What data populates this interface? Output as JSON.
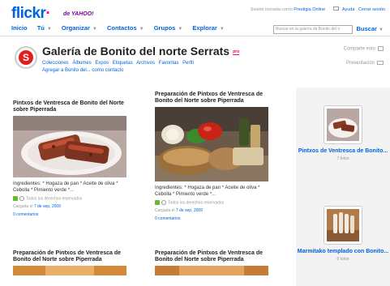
{
  "header": {
    "logo_part1": "flickr",
    "logo_part2": "·",
    "logo_sub": "de YAHOO!",
    "session_prefix": "Sesión iniciada como",
    "session_user": "Prestigia Online",
    "help": "Ayuda",
    "logout": "Cerrar sesión"
  },
  "nav": {
    "items": [
      "Inicio",
      "Tú",
      "Organizar",
      "Contactos",
      "Grupos",
      "Explorar"
    ],
    "search_placeholder": "Buscar en la galería de Bonito del n",
    "search_button": "Buscar"
  },
  "gallery": {
    "title": "Galería de Bonito del norte Serrats",
    "pro_badge": "pro",
    "links": [
      "Colecciones",
      "Álbumes",
      "Expos",
      "Etiquetas",
      "Archivos",
      "Favoritas",
      "Perfil"
    ],
    "add": "Agregar a Bonito del... como contacto",
    "share": "Comparte esto",
    "presentation": "Presentación"
  },
  "cards": [
    {
      "title": "Pintxos de Ventresca de Bonito del Norte sobre Piperrada",
      "desc": "Ingredientes: * Hogaza de pan * Aceite de oliva * Cebolla * Pimiento verde *",
      "more": "...",
      "rights": "Todos los derechos reservados",
      "upload_prefix": "Cargada el",
      "upload_date": "7 de sep, 2009",
      "comments": "0 comentarios"
    },
    {
      "title": "Preparación de Pintxos de Ventresca de Bonito del Norte sobre Piperrada",
      "desc": "Ingredientes: * Hogaza de pan * Aceite de oliva * Cebolla * Pimiento verde *",
      "more": "...",
      "rights": "Todos los derechos reservados",
      "upload_prefix": "Cargada el",
      "upload_date": "7 de sep, 2009",
      "comments": "0 comentarios"
    },
    {
      "title": "Preparación de Pintxos de Ventresca de Bonito del Norte sobre Piperrada"
    },
    {
      "title": "Preparación de Pintxos de Ventresca de Bonito del Norte sobre Piperrada"
    }
  ],
  "sidebar": {
    "items": [
      {
        "title": "Pintxos de Ventresca de Bonito...",
        "count": "7 fotos"
      },
      {
        "title": "Marmitako templado con Bonito...",
        "count": "6 fotos"
      }
    ]
  },
  "colors": {
    "link": "#0063dc",
    "brand_pink": "#ff0084",
    "sidebar_bg": "#f3f3f3"
  }
}
